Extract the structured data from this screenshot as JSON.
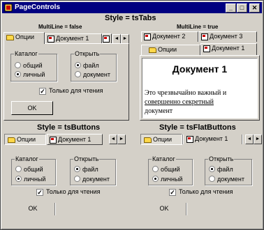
{
  "window": {
    "title": "PageControls"
  },
  "title_buttons": {
    "minimize": "_",
    "maximize": "□",
    "close": "✕"
  },
  "headers": {
    "style_tabs": "Style = tsTabs",
    "multiline_false": "MultiLine = false",
    "multiline_true": "MultiLine = true",
    "style_buttons": "Style = tsButtons",
    "style_flat": "Style = tsFlatButtons"
  },
  "tabs_left": {
    "opcii": "Опции",
    "doc1": "Документ 1",
    "doc_partial": "Д"
  },
  "tabs_right": {
    "doc2": "Документ 2",
    "doc3": "Документ 3",
    "opcii": "Опции",
    "doc1": "Документ 1"
  },
  "tabs_buttons": {
    "opcii": "Опции",
    "doc1": "Документ 1"
  },
  "tabs_flat": {
    "opcii": "Опции",
    "doc1": "Документ 1"
  },
  "options": {
    "catalog_title": "Каталог",
    "catalog_common": "общий",
    "catalog_personal": "личный",
    "open_title": "Открыть",
    "open_file": "файл",
    "open_document": "документ",
    "readonly": "Только для чтения",
    "ok": "OK"
  },
  "document": {
    "heading": "Документ 1",
    "body_line1": "Это чрезвычайно важный и",
    "body_line2": "совершенно секретный",
    "body_line3": "документ"
  },
  "arrows": {
    "left": "◄",
    "right": "►"
  }
}
